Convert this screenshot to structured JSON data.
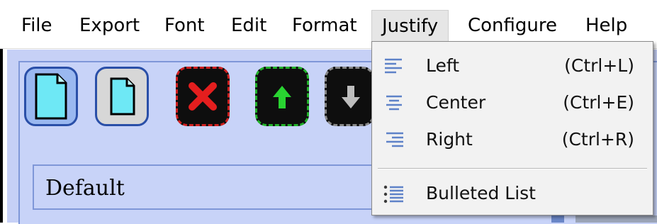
{
  "menubar": {
    "items": [
      {
        "label": "File"
      },
      {
        "label": "Export"
      },
      {
        "label": "Font"
      },
      {
        "label": "Edit"
      },
      {
        "label": "Format"
      },
      {
        "label": "Justify"
      },
      {
        "label": "Configure"
      },
      {
        "label": "Help"
      }
    ],
    "active": "Justify"
  },
  "toolbar": {
    "buttons": [
      {
        "icon": "new-document-icon"
      },
      {
        "icon": "open-document-icon"
      },
      {
        "icon": "delete-x-icon"
      },
      {
        "icon": "move-up-arrow-icon"
      },
      {
        "icon": "move-down-arrow-icon"
      }
    ],
    "style_value": "Default"
  },
  "justify_menu": {
    "items": [
      {
        "label": "Left",
        "shortcut": "(Ctrl+L)",
        "icon": "align-left-icon"
      },
      {
        "label": "Center",
        "shortcut": "(Ctrl+E)",
        "icon": "align-center-icon"
      },
      {
        "label": "Right",
        "shortcut": "(Ctrl+R)",
        "icon": "align-right-icon"
      },
      {
        "label": "Bulleted List",
        "icon": "bulleted-list-icon"
      }
    ]
  },
  "colors": {
    "panel": "#c8d3f8",
    "accent": "#2a4fa8",
    "delete": "#d02020",
    "up": "#22b22a"
  }
}
